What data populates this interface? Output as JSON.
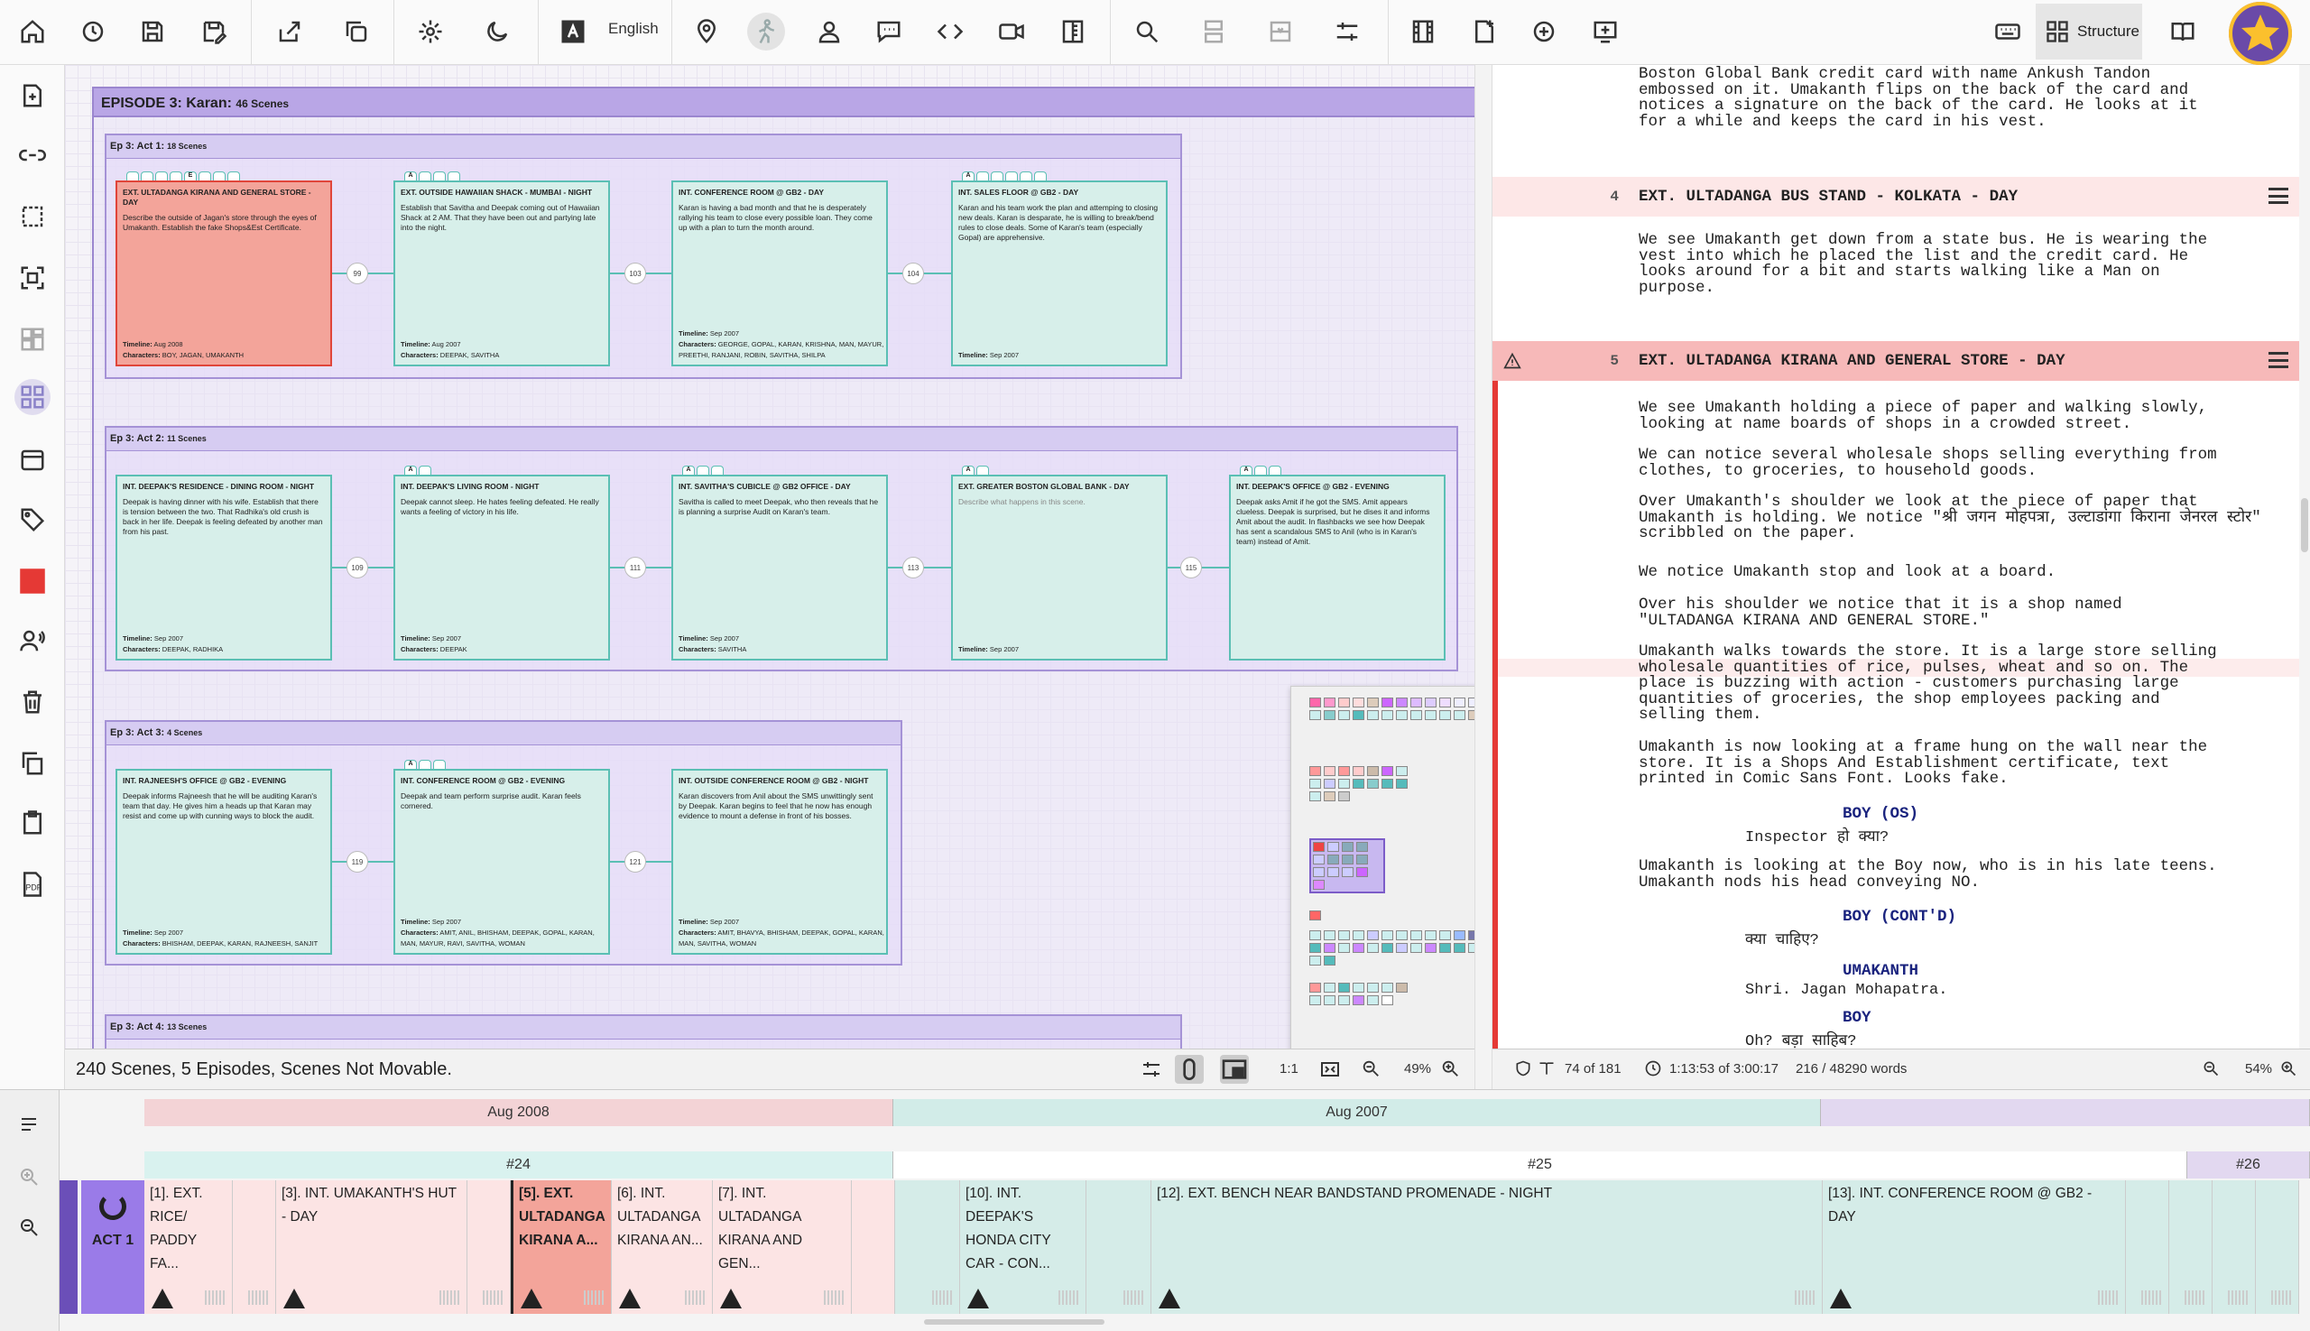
{
  "toolbar": {
    "language": "English",
    "structure_label": "Structure"
  },
  "canvas": {
    "episode": {
      "title": "EPISODE 3: Karan:",
      "count": "46 Scenes"
    },
    "acts": [
      {
        "title": "Ep 3: Act 1:",
        "count": "18 Scenes"
      },
      {
        "title": "Ep 3: Act 2:",
        "count": "11 Scenes"
      },
      {
        "title": "Ep 3: Act 3:",
        "count": "4 Scenes"
      },
      {
        "title": "Ep 3: Act 4:",
        "count": "13 Scenes"
      }
    ],
    "cards": [
      {
        "title": "EXT. ULTADANGA KIRANA AND GENERAL STORE - DAY",
        "desc": "Describe the outside of Jagan's store through the eyes of Umakanth. Establish the fake Shops&Est Certificate.",
        "timeline": "Aug 2008",
        "chars": "BOY, JAGAN, UMAKANTH",
        "tag": "E"
      },
      {
        "title": "EXT. OUTSIDE HAWAIIAN SHACK - MUMBAI - NIGHT",
        "desc": "Establish that Savitha and Deepak coming out of Hawaiian Shack at 2 AM. That they have been out and partying late into the night.",
        "timeline": "Aug 2007",
        "chars": "DEEPAK, SAVITHA",
        "tag": "A"
      },
      {
        "title": "INT. CONFERENCE ROOM @ GB2 - DAY",
        "desc": "Karan is having a bad month and that he is desperately rallying his team to close every possible loan. They come up with a plan to turn the month around.",
        "timeline": "Sep 2007",
        "chars": "GEORGE, GOPAL, KARAN, KRISHNA, MAN, MAYUR, PREETHI, RANJANI, ROBIN, SAVITHA, SHILPA",
        "tag": ""
      },
      {
        "title": "INT. SALES FLOOR @ GB2 - DAY",
        "desc": "Karan and his team work the plan and attemping to closing new deals. Karan is desparate, he is willing to break/bend rules to close deals. Some of Karan's team (especially Gopal) are apprehensive.",
        "timeline": "Sep 2007",
        "chars": "",
        "tag": "A"
      },
      {
        "title": "INT. DEEPAK'S RESIDENCE - DINING ROOM - NIGHT",
        "desc": "Deepak is having dinner with his wife. Establish that there is tension between the two. That Radhika's old crush is back in her life. Deepak is feeling defeated by another man from his past.",
        "timeline": "Sep 2007",
        "chars": "DEEPAK, RADHIKA",
        "tag": ""
      },
      {
        "title": "INT. DEEPAK'S LIVING ROOM - NIGHT",
        "desc": "Deepak cannot sleep. He hates feeling defeated. He really wants a feeling of victory in his life.",
        "timeline": "Sep 2007",
        "chars": "DEEPAK",
        "tag": "A"
      },
      {
        "title": "INT. SAVITHA'S CUBICLE @ GB2 OFFICE - DAY",
        "desc": "Savitha is called to meet Deepak, who then reveals that he is planning a surprise Audit on Karan's team.",
        "timeline": "Sep 2007",
        "chars": "SAVITHA",
        "tag": "A"
      },
      {
        "title": "EXT. GREATER BOSTON GLOBAL BANK - DAY",
        "desc": "Describe what happens in this scene.",
        "timeline": "Sep 2007",
        "chars": "",
        "tag": "A"
      },
      {
        "title": "INT. DEEPAK'S OFFICE @ GB2 - EVENING",
        "desc": "Deepak asks Amit if he got the SMS. Amit appears clueless. Deepak is surprised, but he dises it and informs Amit about the audit. In flashbacks we see how Deepak has sent a scandalous SMS to Anil (who is in Karan's team) instead of Amit.",
        "timeline": "",
        "chars": "",
        "tag": "A"
      },
      {
        "title": "INT. RAJNEESH'S OFFICE @ GB2 - EVENING",
        "desc": "Deepak informs Rajneesh that he will be auditing Karan's team that day. He gives him a heads up that Karan may resist and come up with cunning ways to block the audit.",
        "timeline": "Sep 2007",
        "chars": "BHISHAM, DEEPAK, KARAN, RAJNEESH, SANJIT",
        "tag": ""
      },
      {
        "title": "INT. CONFERENCE ROOM @ GB2 - EVENING",
        "desc": "Deepak and team perform surprise audit. Karan feels cornered.",
        "timeline": "Sep 2007",
        "chars": "AMIT, ANIL, BHISHAM, DEEPAK, GOPAL, KARAN, MAN, MAYUR, RAVI, SAVITHA, WOMAN",
        "tag": "A"
      },
      {
        "title": "INT. OUTSIDE CONFERENCE ROOM @ GB2 - NIGHT",
        "desc": "Karan discovers from Anil about the SMS unwittingly sent by Deepak. Karan begins to feel that he now has enough evidence to mount a defense in front of his bosses.",
        "timeline": "Sep 2007",
        "chars": "AMIT, BHAVYA, BHISHAM, DEEPAK, GOPAL, KARAN, MAN, SAVITHA, WOMAN",
        "tag": ""
      }
    ],
    "links": [
      "99",
      "103",
      "104",
      "109",
      "111",
      "113",
      "115",
      "119",
      "121"
    ],
    "labels": {
      "timeline": "Timeline:",
      "characters": "Characters:"
    }
  },
  "canvas_status": {
    "text": "240 Scenes, 5 Episodes, Scenes Not Movable.",
    "ratio": "1:1",
    "zoom": "49%"
  },
  "screenplay": {
    "p0": "Boston Global Bank credit card with name Ankush Tandon\nembossed on it. Umakanth flips on the back of the card and\nnotices a signature on the back of the card. He looks at it\nfor a while and keeps the card in his vest.",
    "scene4": {
      "num": "4",
      "heading": "EXT. ULTADANGA BUS STAND - KOLKATA - DAY"
    },
    "p1": "We see Umakanth get down from a state bus. He is wearing the\nvest into which he placed the list and the credit card. He\nlooks around for a bit and starts walking like a Man on\npurpose.",
    "scene5": {
      "num": "5",
      "heading": "EXT. ULTADANGA KIRANA AND GENERAL STORE - DAY"
    },
    "p2": "We see Umakanth holding a piece of paper and walking slowly,\nlooking at name boards of shops in a crowded street.",
    "p3": "We can notice several wholesale shops selling everything from\nclothes, to groceries, to household goods.",
    "p4": "Over Umakanth's shoulder we look at the piece of paper that\nUmakanth is holding. We notice \"श्री जगन मोहपत्रा, उल्टाडांगा किराना जेनरल स्टोर\"\nscribbled on the paper.",
    "p5": "We notice Umakanth stop and look at a board.",
    "p6": "Over his shoulder we notice that it is a shop named\n\"ULTADANGA KIRANA AND GENERAL STORE.\"",
    "p7": "Umakanth walks towards the store. It is a large store selling\nwholesale quantities of rice, pulses, wheat and so on. The\nplace is buzzing with action - customers purchasing large\nquantities of groceries, the shop employees packing and\nselling them.",
    "p8": "Umakanth is now looking at a frame hung on the wall near the\nstore. It is a Shops And Establishment certificate, text\nprinted in Comic Sans Font. Looks fake.",
    "c1": "BOY (OS)",
    "d1": "Inspector हो क्या?",
    "p9": "Umakanth is looking at the Boy now, who is in his late teens.\nUmakanth nods his head conveying NO.",
    "c2": "BOY (CONT'D)",
    "d2": "क्या चाहिए?",
    "c3": "UMAKANTH",
    "d3": "Shri. Jagan Mohapatra.",
    "c4": "BOY",
    "d4": "Oh? बड़ा साहिब?"
  },
  "sp_status": {
    "pages": "74 of 181",
    "time": "1:13:53 of 3:00:17",
    "words": "216 / 48290 words",
    "zoom": "54%"
  },
  "timeline": {
    "months": [
      "Aug 2008",
      "Aug 2007"
    ],
    "episodes": [
      "#24",
      "#25",
      "#26"
    ],
    "act_label": "ACT 1",
    "scenes": [
      "[1]. EXT. RICE/ PADDY FA...",
      "[3]. INT. UMAKANTH'S HUT - DAY",
      "[5]. EXT. ULTADANGA KIRANA A...",
      "[6]. INT. ULTADANGA KIRANA AN...",
      "[7]. INT. ULTADANGA KIRANA AND GEN...",
      "[10]. INT. DEEPAK'S HONDA CITY CAR - CON...",
      "[12]. EXT. BENCH NEAR BANDSTAND PROMENADE - NIGHT",
      "[13]. INT. CONFERENCE ROOM @ GB2 - DAY"
    ]
  }
}
